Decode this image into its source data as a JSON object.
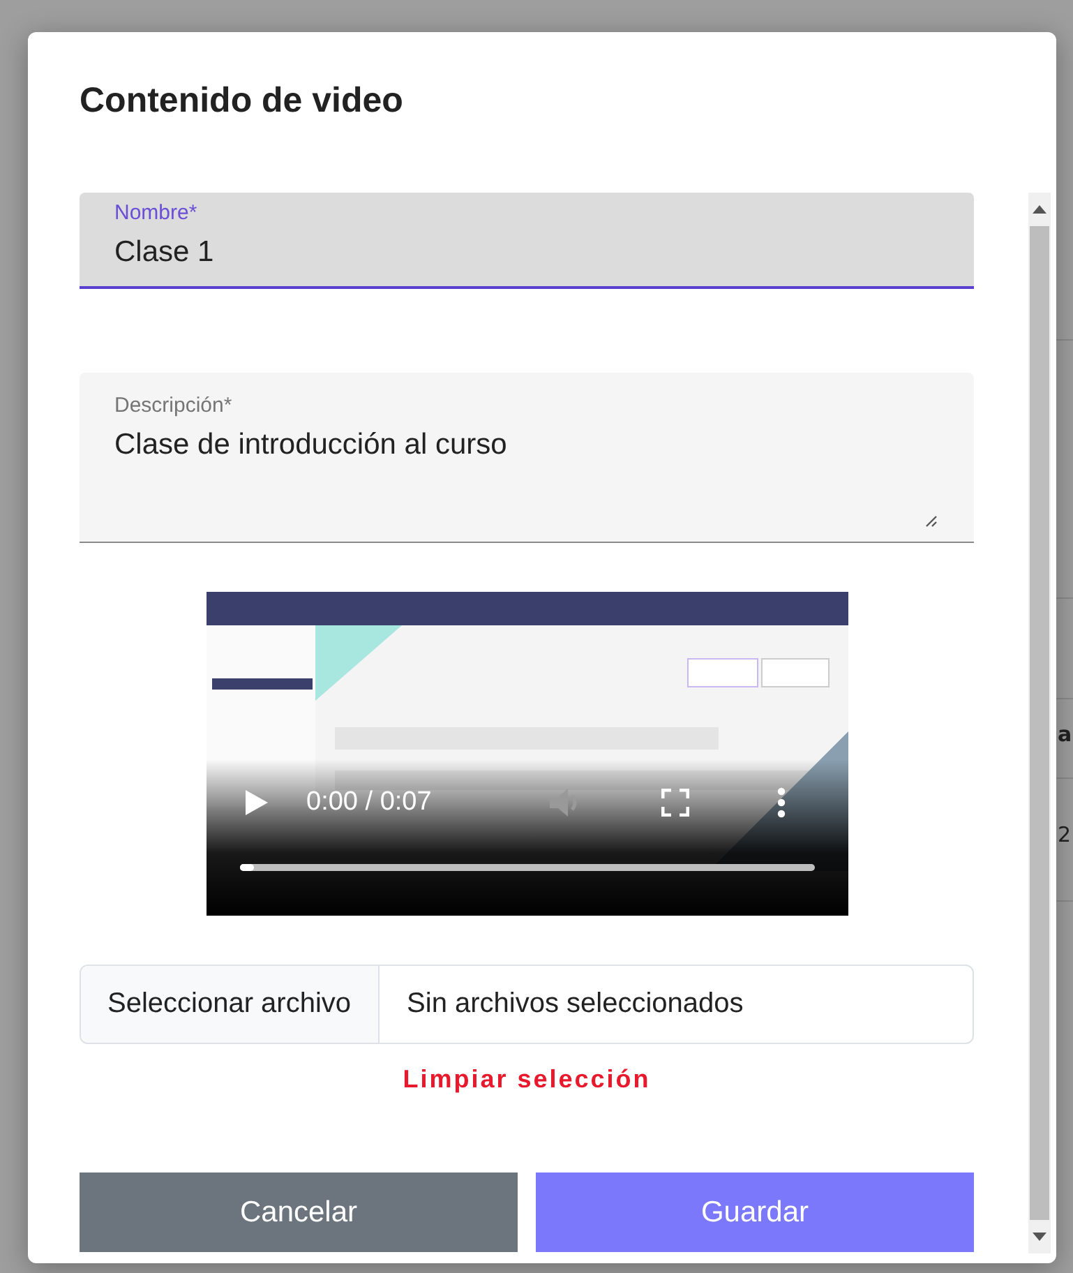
{
  "backdrop": {
    "fragments": [
      "a",
      "2"
    ]
  },
  "dialog": {
    "title": "Contenido de video"
  },
  "fields": [
    {
      "kind": "input",
      "label": "Nombre*",
      "value": "Clase 1",
      "focused": true
    },
    {
      "kind": "textarea",
      "label": "Descripción*",
      "value": "Clase de introducción al curso",
      "focused": false
    }
  ],
  "video": {
    "kind": "picture",
    "time": "0:00 / 0:07",
    "level": 0.0
  },
  "file_input": {
    "button": "Seleccionar archivo",
    "status": "Sin archivos seleccionados"
  },
  "clear_link": "Limpiar selección",
  "buttons": [
    {
      "kind": "secondary",
      "label": "Cancelar"
    },
    {
      "kind": "primary",
      "label": "Guardar"
    }
  ]
}
